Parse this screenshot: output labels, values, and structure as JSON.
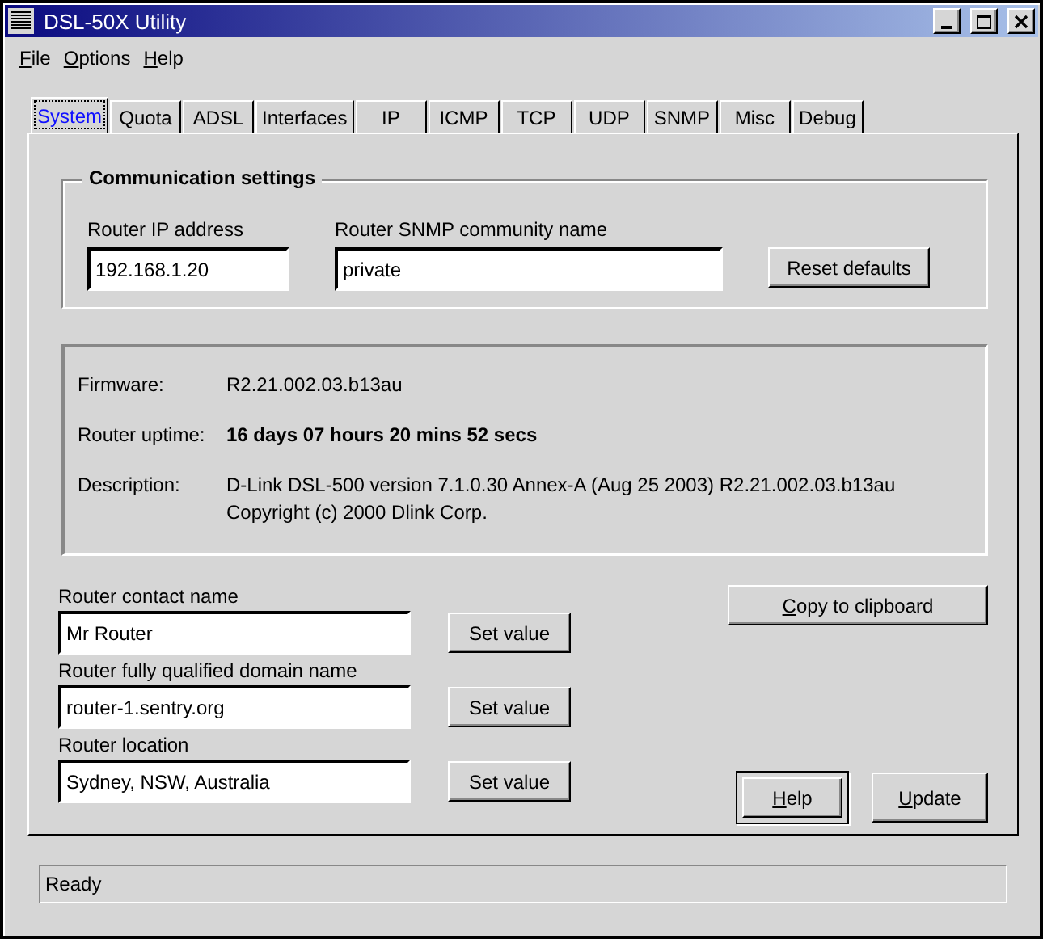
{
  "window": {
    "title": "DSL-50X Utility"
  },
  "menu": [
    {
      "label": "File",
      "mnemonic": true
    },
    {
      "label": "Options",
      "mnemonic": true
    },
    {
      "label": "Help",
      "mnemonic": true
    }
  ],
  "tabs": [
    {
      "label": "System",
      "selected": true
    },
    {
      "label": "Quota",
      "selected": false
    },
    {
      "label": "ADSL",
      "selected": false
    },
    {
      "label": "Interfaces",
      "selected": false
    },
    {
      "label": "IP",
      "selected": false
    },
    {
      "label": "ICMP",
      "selected": false
    },
    {
      "label": "TCP",
      "selected": false
    },
    {
      "label": "UDP",
      "selected": false
    },
    {
      "label": "SNMP",
      "selected": false
    },
    {
      "label": "Misc",
      "selected": false
    },
    {
      "label": "Debug",
      "selected": false
    }
  ],
  "communication": {
    "title": "Communication settings",
    "ip_label": "Router IP address",
    "ip_value": "192.168.1.20",
    "community_label": "Router SNMP community name",
    "community_value": "private",
    "reset_button": "Reset defaults"
  },
  "info": [
    {
      "label": "Firmware:",
      "lines": [
        "R2.21.002.03.b13au"
      ],
      "bold": false
    },
    {
      "label": "Router uptime:",
      "lines": [
        "16 days 07 hours 20 mins 52 secs"
      ],
      "bold": true
    },
    {
      "label": "Description:",
      "lines": [
        "D-Link DSL-500 version 7.1.0.30 Annex-A (Aug 25 2003) R2.21.002.03.b13au",
        "Copyright (c) 2000 Dlink Corp."
      ],
      "bold": false
    }
  ],
  "fields": [
    {
      "label": "Router contact name",
      "value": "Mr Router",
      "button": "Set value"
    },
    {
      "label": "Router fully qualified domain name",
      "value": "router-1.sentry.org",
      "button": "Set value"
    },
    {
      "label": "Router location",
      "value": "Sydney, NSW, Australia",
      "button": "Set value"
    }
  ],
  "copy_button": {
    "label": "Copy to clipboard",
    "mnemonic": true
  },
  "buttons": [
    {
      "label": "Help",
      "mnemonic": true,
      "default": true
    },
    {
      "label": "Update",
      "mnemonic": true,
      "default": false
    }
  ],
  "status_bar": "Ready"
}
